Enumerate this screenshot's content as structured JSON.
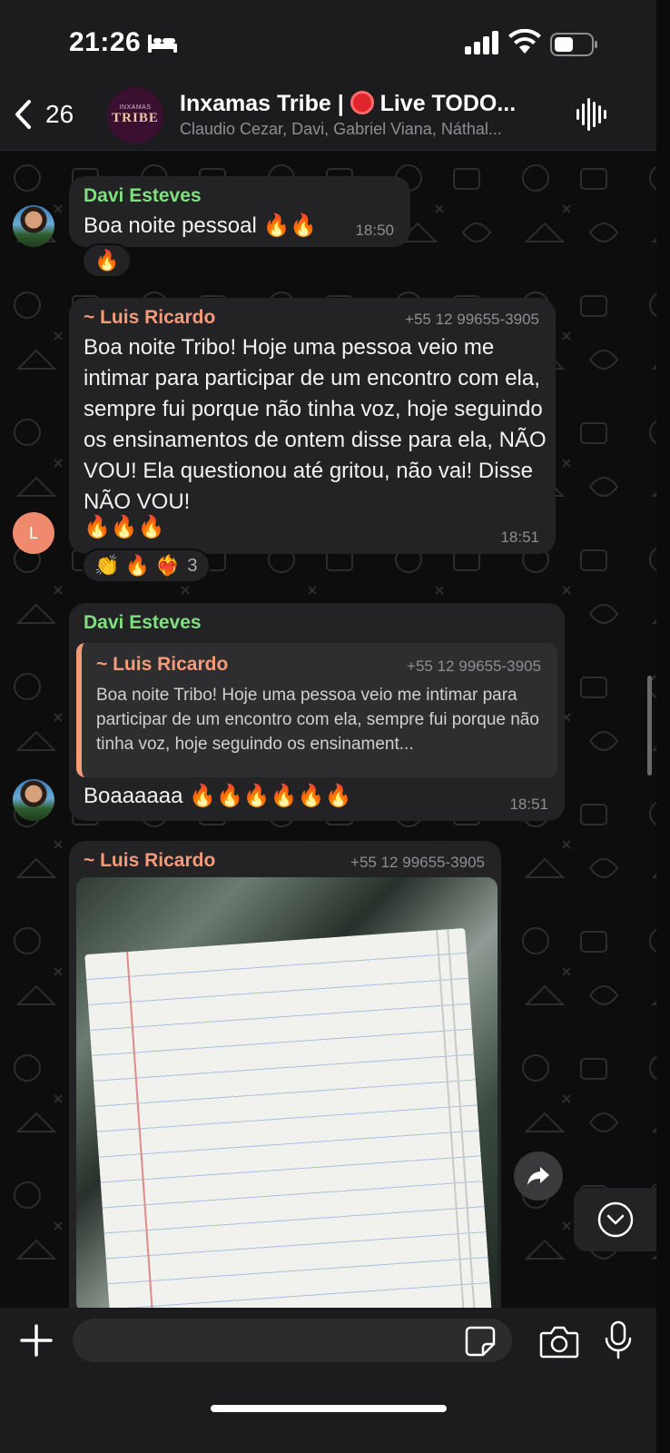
{
  "status_bar": {
    "time": "21:26"
  },
  "header": {
    "back_count": "26",
    "avatar_small": "INXAMAS",
    "avatar_big": "TRIBE",
    "title_prefix": "Inxamas Tribe | ",
    "title_suffix": " Live TODO...",
    "members": "Claudio Cezar, Davi, Gabriel Viana, Náthal..."
  },
  "messages": [
    {
      "sender": "Davi Esteves",
      "text": "Boa noite pessoal 🔥🔥",
      "time": "18:50",
      "reactions": "🔥"
    },
    {
      "sender": "~ Luis Ricardo",
      "phone": "+55 12 99655-3905",
      "avatar_letter": "L",
      "text": "Boa noite Tribo! Hoje uma pessoa veio me intimar para participar de um encontro com ela, sempre fui porque não tinha voz, hoje seguindo os ensinamentos de ontem disse para ela, NÃO VOU! Ela questionou até gritou, não vai! Disse NÃO VOU!",
      "emoji_line": "🔥🔥🔥",
      "time": "18:51",
      "reactions": "👏 🔥 ❤️‍🔥",
      "reaction_count": "3"
    },
    {
      "sender": "Davi Esteves",
      "quote_sender": "~ Luis Ricardo",
      "quote_phone": "+55 12 99655-3905",
      "quote_text": "Boa noite Tribo! Hoje uma pessoa veio me intimar para participar de um encontro com ela, sempre fui porque não tinha voz, hoje seguindo os ensinament...",
      "text": "Boaaaaaa 🔥🔥🔥🔥🔥🔥",
      "time": "18:51"
    },
    {
      "sender": "~ Luis Ricardo",
      "phone": "+55 12 99655-3905"
    }
  ],
  "input": {
    "placeholder": ""
  },
  "colors": {
    "header_bg": "#1c1c1e",
    "bubble_bg": "#232325",
    "green_sender": "#7fe07f",
    "orange_sender": "#f59b7b"
  }
}
